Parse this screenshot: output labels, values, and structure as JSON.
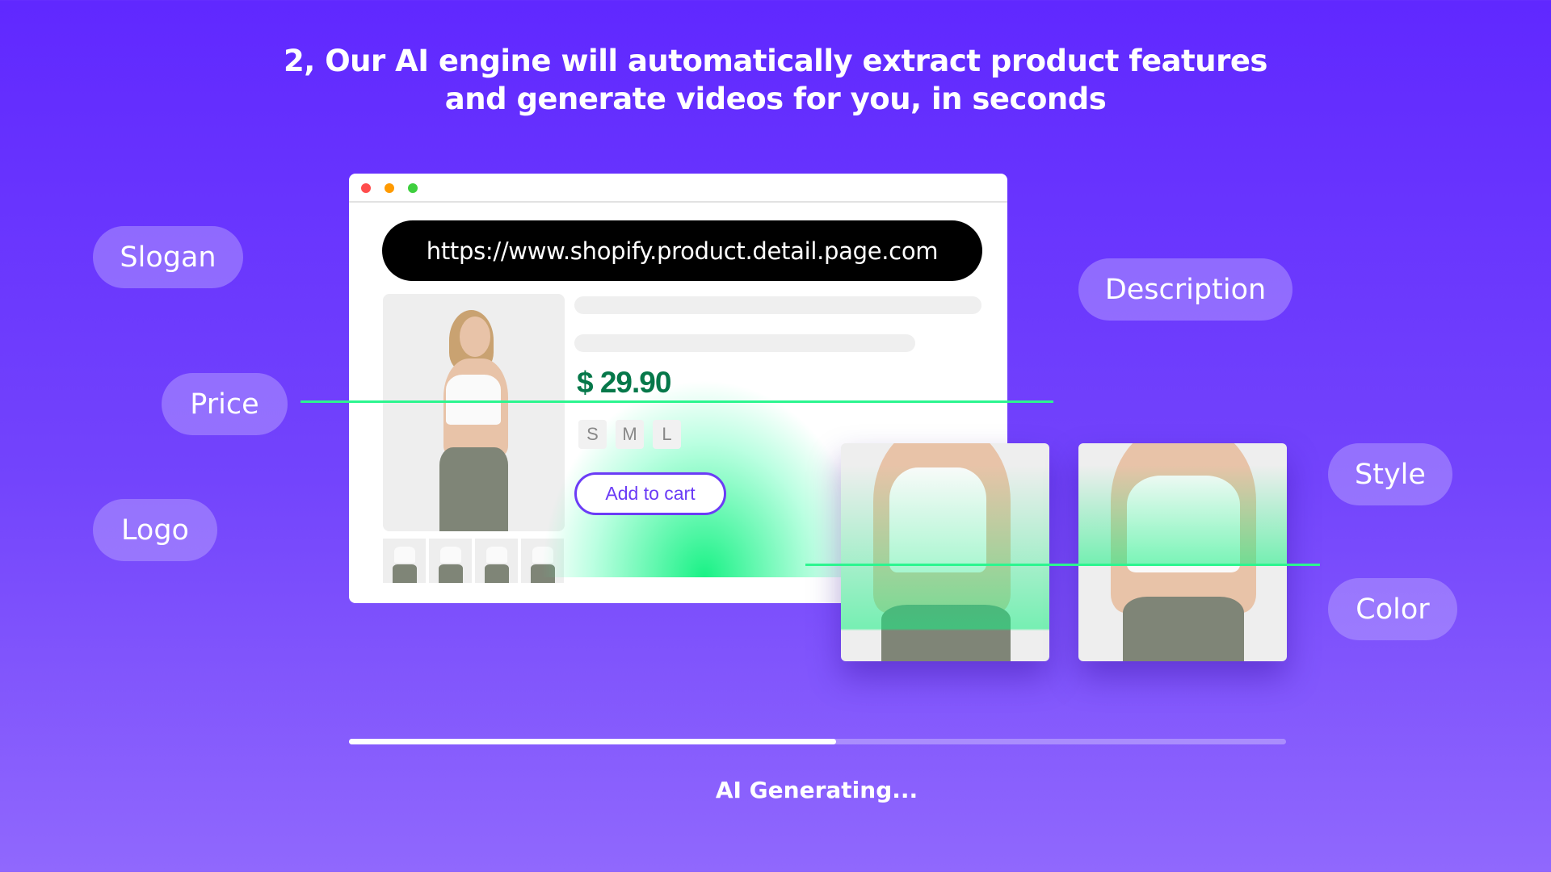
{
  "header": {
    "line1": "2, Our AI engine will automatically extract product features",
    "line2": "and generate videos for you, in seconds"
  },
  "tags": {
    "slogan": "Slogan",
    "price": "Price",
    "logo": "Logo",
    "description": "Description",
    "style": "Style",
    "color": "Color"
  },
  "browser": {
    "url": "https://www.shopify.product.detail.page.com",
    "price": "$ 29.90",
    "sizes": [
      "S",
      "M",
      "L"
    ],
    "add_to_cart": "Add to cart",
    "window_dots": {
      "close": "#ff4d4d",
      "minimize": "#ff9a00",
      "maximize": "#3ecf3e"
    }
  },
  "progress": {
    "percent": 52,
    "status": "AI Generating..."
  },
  "colors": {
    "accent": "#6b3cf6",
    "scan": "#2cf58f",
    "price": "#06784a"
  }
}
